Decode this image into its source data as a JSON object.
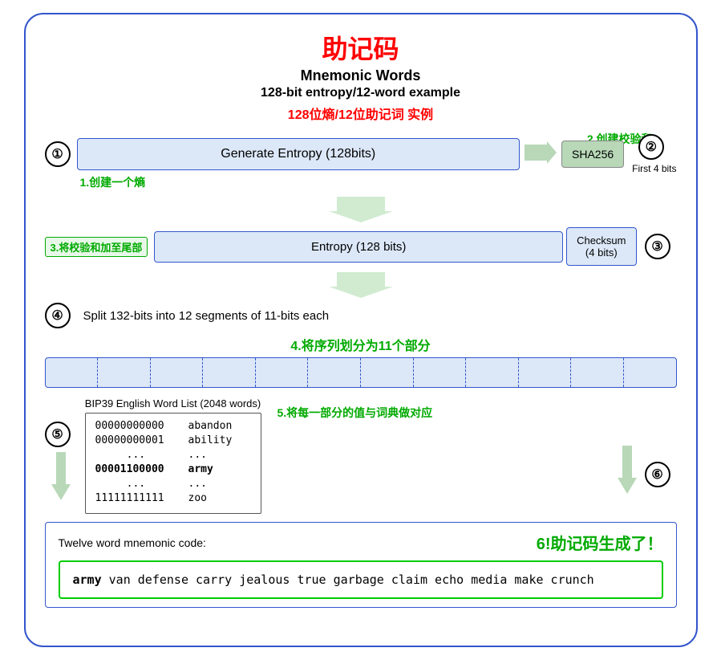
{
  "title": {
    "zh": "助记码",
    "en1": "Mnemonic Words",
    "en2": "128-bit entropy/12-word example",
    "zh2": "128位熵/12位助记词 实例"
  },
  "labels": {
    "create_entropy": "1.创建一个熵",
    "create_checksum": "2.创建校验和",
    "add_checksum": "3.将校验和加至尾部",
    "split_label": "4.将序列划分为11个部分",
    "split_desc": "Split 132-bits into 12 segments of 11-bits each",
    "dict_match": "5.将每一部分的值与词典做对应",
    "result_label": "6!助记码生成了！",
    "twelve_word": "Twelve word mnemonic code:"
  },
  "boxes": {
    "generate_entropy": "Generate Entropy (128bits)",
    "sha256": "SHA256",
    "first4bits": "First 4 bits",
    "entropy128": "Entropy (128 bits)",
    "checksum": "Checksum\n(4 bits)",
    "step2": "②",
    "step3": "③"
  },
  "bip39": {
    "label": "BIP39 English Word List (2048 words)",
    "rows": [
      {
        "code": "00000000000",
        "word": "abandon"
      },
      {
        "code": "00000000001",
        "word": "ability"
      },
      {
        "code": "...",
        "word": "..."
      },
      {
        "code": "00001100000",
        "word": "army",
        "bold": true
      },
      {
        "code": "...",
        "word": "..."
      },
      {
        "code": "11111111111",
        "word": "zoo"
      }
    ]
  },
  "mnemonic": {
    "bold_word": "army",
    "rest": " van defense carry jealous true\ngarbage claim echo media make crunch"
  },
  "colors": {
    "red": "#ff0000",
    "green": "#00aa00",
    "blue": "#3355cc",
    "light_blue": "#dce8f8",
    "light_green": "#b8d8b8"
  }
}
